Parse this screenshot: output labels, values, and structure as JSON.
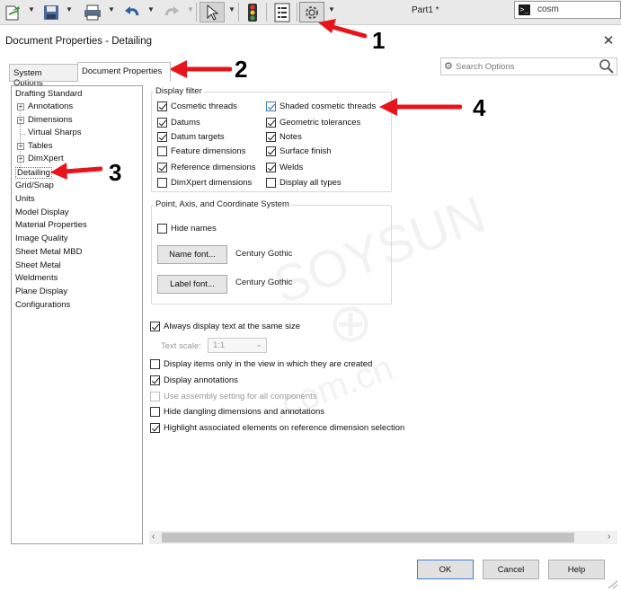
{
  "toolbar": {
    "doc_title": "Part1 *",
    "command_search_value": "cosm",
    "icons": [
      "new-document-icon",
      "save-icon",
      "print-icon",
      "undo-icon",
      "redo-icon",
      "select-pointer-icon",
      "traffic-light-icon",
      "file-properties-icon",
      "options-gear-icon"
    ]
  },
  "dialog": {
    "title": "Document Properties - Detailing",
    "close_glyph": "✕",
    "tabs": [
      {
        "label": "System Options",
        "active": false
      },
      {
        "label": "Document Properties",
        "active": true
      }
    ],
    "search_placeholder": "Search Options"
  },
  "tree": {
    "items": [
      {
        "label": "Drafting Standard",
        "level": 0,
        "expandable": false
      },
      {
        "label": "Annotations",
        "level": 1,
        "expandable": true
      },
      {
        "label": "Dimensions",
        "level": 1,
        "expandable": true
      },
      {
        "label": "Virtual Sharps",
        "level": 1,
        "expandable": false
      },
      {
        "label": "Tables",
        "level": 1,
        "expandable": true
      },
      {
        "label": "DimXpert",
        "level": 1,
        "expandable": true
      },
      {
        "label": "Detailing",
        "level": 0,
        "expandable": false,
        "selected": true
      },
      {
        "label": "Grid/Snap",
        "level": 0,
        "expandable": false
      },
      {
        "label": "Units",
        "level": 0,
        "expandable": false
      },
      {
        "label": "Model Display",
        "level": 0,
        "expandable": false
      },
      {
        "label": "Material Properties",
        "level": 0,
        "expandable": false
      },
      {
        "label": "Image Quality",
        "level": 0,
        "expandable": false
      },
      {
        "label": "Sheet Metal MBD",
        "level": 0,
        "expandable": false
      },
      {
        "label": "Sheet Metal",
        "level": 0,
        "expandable": false
      },
      {
        "label": "Weldments",
        "level": 0,
        "expandable": false
      },
      {
        "label": "Plane Display",
        "level": 0,
        "expandable": false
      },
      {
        "label": "Configurations",
        "level": 0,
        "expandable": false
      }
    ]
  },
  "display_filter": {
    "label": "Display filter",
    "left_column": [
      {
        "label": "Cosmetic threads",
        "checked": true
      },
      {
        "label": "Datums",
        "checked": true
      },
      {
        "label": "Datum targets",
        "checked": true
      },
      {
        "label": "Feature dimensions",
        "checked": false
      },
      {
        "label": "Reference dimensions",
        "checked": true
      },
      {
        "label": "DimXpert dimensions",
        "checked": false
      }
    ],
    "right_column": [
      {
        "label": "Shaded cosmetic threads",
        "checked": true
      },
      {
        "label": "Geometric tolerances",
        "checked": true
      },
      {
        "label": "Notes",
        "checked": true
      },
      {
        "label": "Surface finish",
        "checked": true
      },
      {
        "label": "Welds",
        "checked": true
      },
      {
        "label": "Display all types",
        "checked": false
      }
    ]
  },
  "point_axis": {
    "label": "Point, Axis, and Coordinate System",
    "hide_names": {
      "label": "Hide names",
      "checked": false
    },
    "name_font_button": "Name font...",
    "name_font_value": "Century Gothic",
    "label_font_button": "Label font...",
    "label_font_value": "Century Gothic"
  },
  "options": {
    "always_same_size": {
      "label": "Always display text at the same size",
      "checked": true
    },
    "text_scale_label": "Text scale:",
    "text_scale_value": "1:1",
    "only_in_view": {
      "label": "Display items only in the view in which they are created",
      "checked": false
    },
    "display_annotations": {
      "label": "Display annotations",
      "checked": true
    },
    "use_assembly": {
      "label": "Use assembly setting for all components",
      "checked": false,
      "disabled": true
    },
    "hide_dangling": {
      "label": "Hide dangling dimensions and annotations",
      "checked": false
    },
    "highlight_assoc": {
      "label": "Highlight associated elements on reference dimension selection",
      "checked": true
    }
  },
  "buttons": {
    "ok": "OK",
    "cancel": "Cancel",
    "help": "Help"
  },
  "annotations": {
    "numbers": [
      "1",
      "2",
      "3",
      "4"
    ],
    "arrow_color": "#e8141c"
  }
}
